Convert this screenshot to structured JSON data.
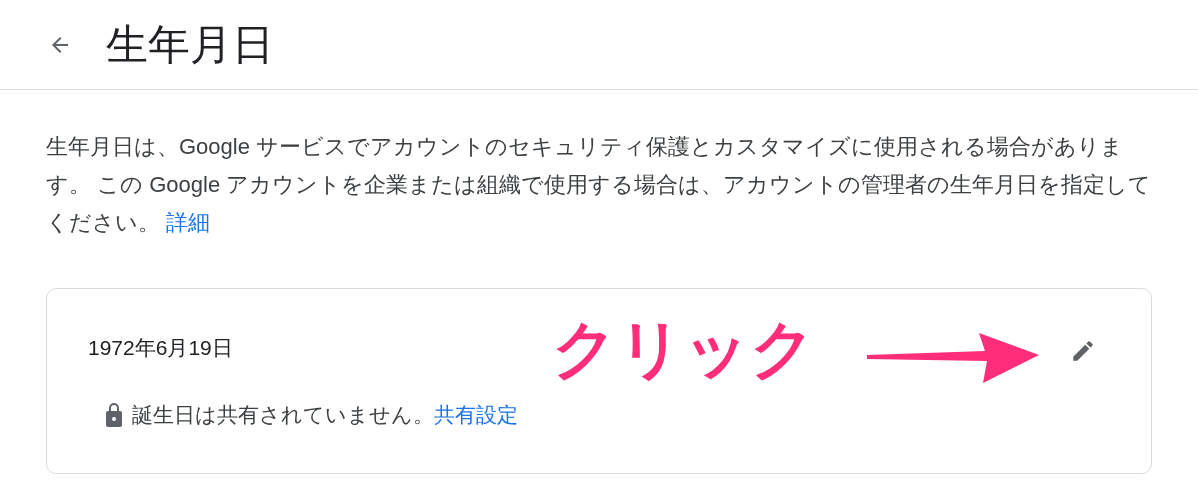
{
  "header": {
    "title": "生年月日"
  },
  "description": {
    "text": "生年月日は、Google サービスでアカウントのセキュリティ保護とカスタマイズに使用される場合があります。 この Google アカウントを企業または組織で使用する場合は、アカウントの管理者の生年月日を指定してください。 ",
    "link": "詳細"
  },
  "card": {
    "birthday": "1972年6月19日",
    "sharing_text": "誕生日は共有されていません。",
    "sharing_link": "共有設定"
  },
  "annotation": {
    "text": "クリック"
  }
}
